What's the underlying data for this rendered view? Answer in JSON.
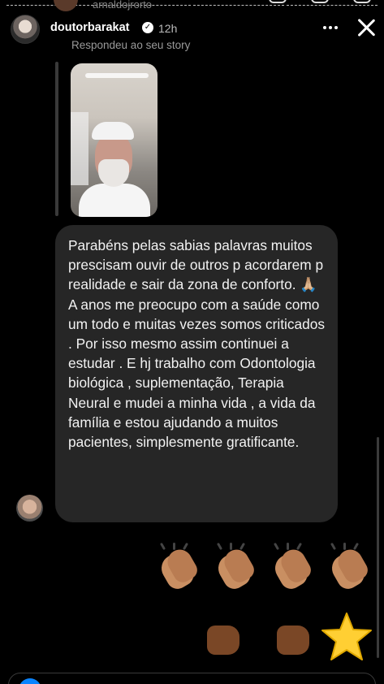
{
  "top_clip": {
    "name": "arnaldojrorto"
  },
  "header": {
    "username": "doutorbarakat",
    "time": "12h"
  },
  "reply": {
    "label": "Respondeu ao seu story"
  },
  "message": {
    "text": "Parabéns pelas sabias palavras muitos prescisam ouvir de outros p acordarem p realidade e sair da zona de conforto. 🙏🏼\nA anos me preocupo com a saúde como um todo e muitas vezes somos criticados . Por isso mesmo assim continuei a estudar . E hj trabalho com Odontologia biológica , suplementação, Terapia Neural e mudei a minha vida , a vida da família e estou ajudando a muitos pacientes, simplesmente gratificante."
  },
  "reactions": {
    "row1": [
      "clapping-hands-medium-skin",
      "clapping-hands-medium-skin",
      "clapping-hands-medium-skin",
      "clapping-hands-medium-skin"
    ],
    "row2": [
      "left-facing-fist-dark-skin",
      "right-facing-fist-dark-skin",
      "star"
    ]
  },
  "colors": {
    "background": "#000000",
    "bubble": "#262626",
    "accent": "#0a84ff"
  }
}
